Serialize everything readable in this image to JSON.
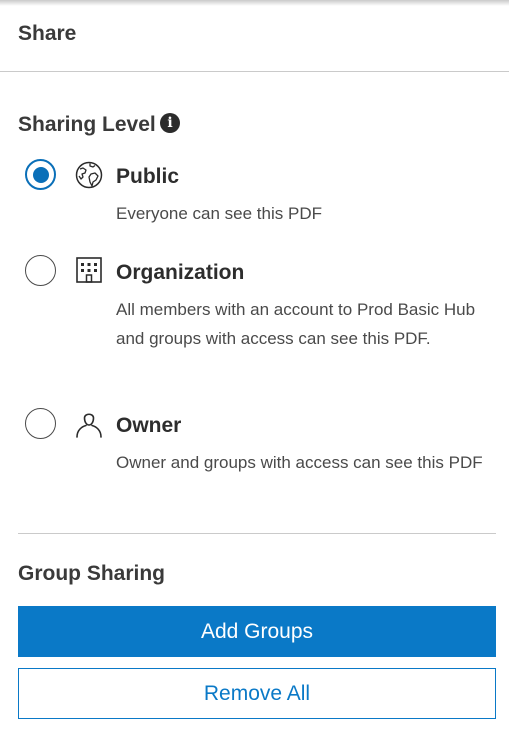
{
  "header": {
    "title": "Share"
  },
  "sharing_level": {
    "title": "Sharing Level",
    "options": [
      {
        "label": "Public",
        "description": "Everyone can see this PDF",
        "selected": true,
        "icon": "globe-icon"
      },
      {
        "label": "Organization",
        "description": "All members with an account to Prod Basic Hub and groups with access can see this PDF.",
        "selected": false,
        "icon": "building-icon"
      },
      {
        "label": "Owner",
        "description": "Owner and groups with access can see this PDF",
        "selected": false,
        "icon": "user-icon"
      }
    ]
  },
  "group_sharing": {
    "title": "Group Sharing",
    "add_label": "Add Groups",
    "remove_label": "Remove All"
  },
  "colors": {
    "accent": "#0a79c7",
    "radio_selected": "#0a6fb8",
    "divider": "#cacaca"
  }
}
